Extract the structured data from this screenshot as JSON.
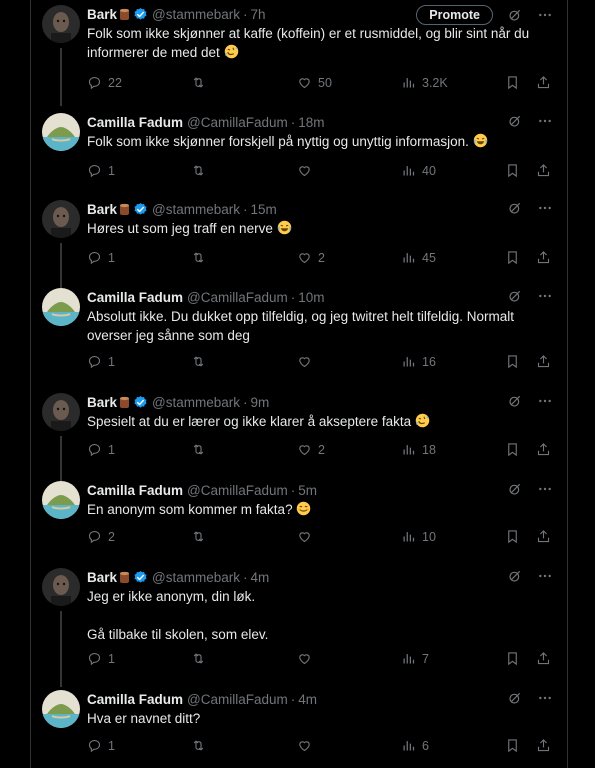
{
  "colors": {
    "background": "#000000",
    "text": "#e7e9ea",
    "muted": "#71767b",
    "verified": "#1d9bf0",
    "divider": "#2f3336"
  },
  "promote_label": "Promote",
  "tweets": [
    {
      "name": "Bark",
      "handle": "@stammebark",
      "time": "7h",
      "text": "Folk som ikke skjønner at kaffe (koffein) er et rusmiddel, og blir sint når du informerer de med det",
      "emoji": "rofl",
      "replies": "22",
      "retweets": "",
      "likes": "50",
      "views": "3.2K"
    },
    {
      "name": "Camilla Fadum",
      "handle": "@CamillaFadum",
      "time": "18m",
      "text": "Folk som ikke skjønner forskjell på nyttig og unyttig informasjon.",
      "emoji": "joy",
      "replies": "1",
      "retweets": "",
      "likes": "",
      "views": "40"
    },
    {
      "name": "Bark",
      "handle": "@stammebark",
      "time": "15m",
      "text": "Høres ut som jeg traff en nerve",
      "emoji": "joy",
      "replies": "1",
      "retweets": "",
      "likes": "2",
      "views": "45"
    },
    {
      "name": "Camilla Fadum",
      "handle": "@CamillaFadum",
      "time": "10m",
      "text": "Absolutt ikke. Du dukket opp tilfeldig, og jeg twitret helt tilfeldig. Normalt overser jeg sånne som deg",
      "emoji": "",
      "replies": "1",
      "retweets": "",
      "likes": "",
      "views": "16"
    },
    {
      "name": "Bark",
      "handle": "@stammebark",
      "time": "9m",
      "text": "Spesielt at du er lærer og ikke klarer å akseptere fakta",
      "emoji": "rofl",
      "replies": "1",
      "retweets": "",
      "likes": "2",
      "views": "18"
    },
    {
      "name": "Camilla Fadum",
      "handle": "@CamillaFadum",
      "time": "5m",
      "text": "En anonym som kommer m fakta?",
      "emoji": "smile",
      "replies": "2",
      "retweets": "",
      "likes": "",
      "views": "10"
    },
    {
      "name": "Bark",
      "handle": "@stammebark",
      "time": "4m",
      "text": "Jeg er ikke anonym, din løk.\n\nGå tilbake til skolen, som elev.",
      "emoji": "",
      "replies": "1",
      "retweets": "",
      "likes": "",
      "views": "7"
    },
    {
      "name": "Camilla Fadum",
      "handle": "@CamillaFadum",
      "time": "4m",
      "text": "Hva er navnet ditt?",
      "emoji": "",
      "replies": "1",
      "retweets": "",
      "likes": "",
      "views": "6"
    }
  ]
}
